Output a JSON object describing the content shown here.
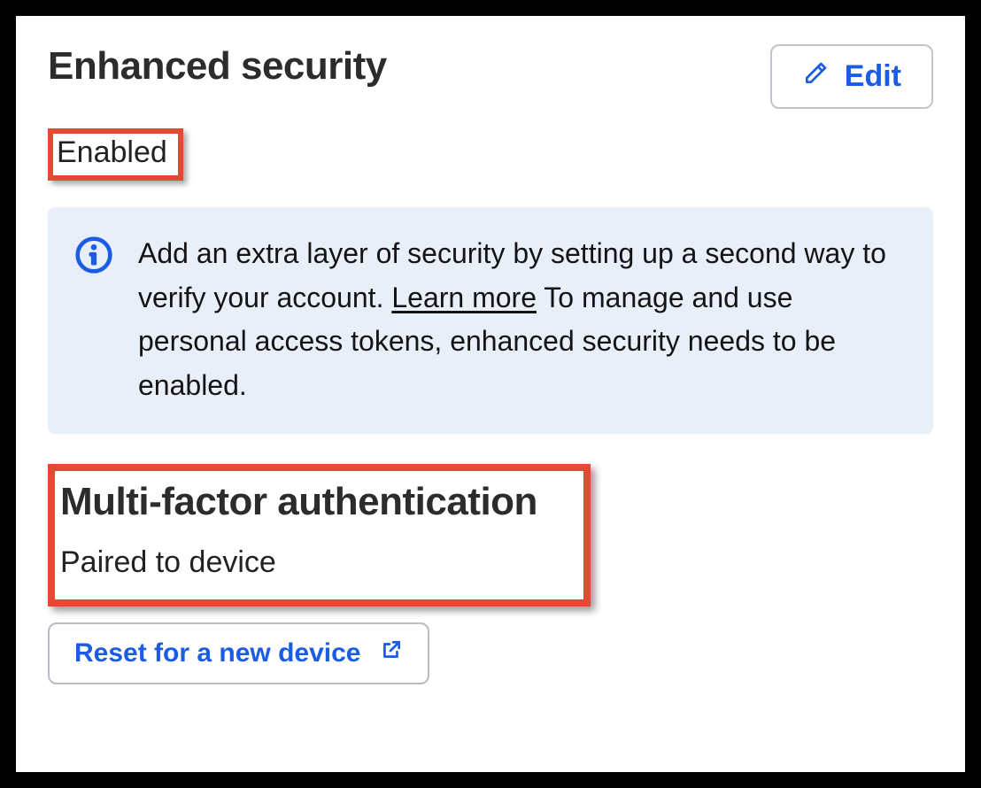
{
  "header": {
    "title": "Enhanced security",
    "edit_label": "Edit"
  },
  "status": {
    "value": "Enabled"
  },
  "info": {
    "text_part1": "Add an extra layer of security by setting up a second way to verify your account. ",
    "learn_more": "Learn more",
    "text_part2": " To manage and use personal access tokens, enhanced security needs to be enabled."
  },
  "mfa": {
    "title": "Multi-factor authentication",
    "status": "Paired to device",
    "reset_label": "Reset for a new device"
  }
}
